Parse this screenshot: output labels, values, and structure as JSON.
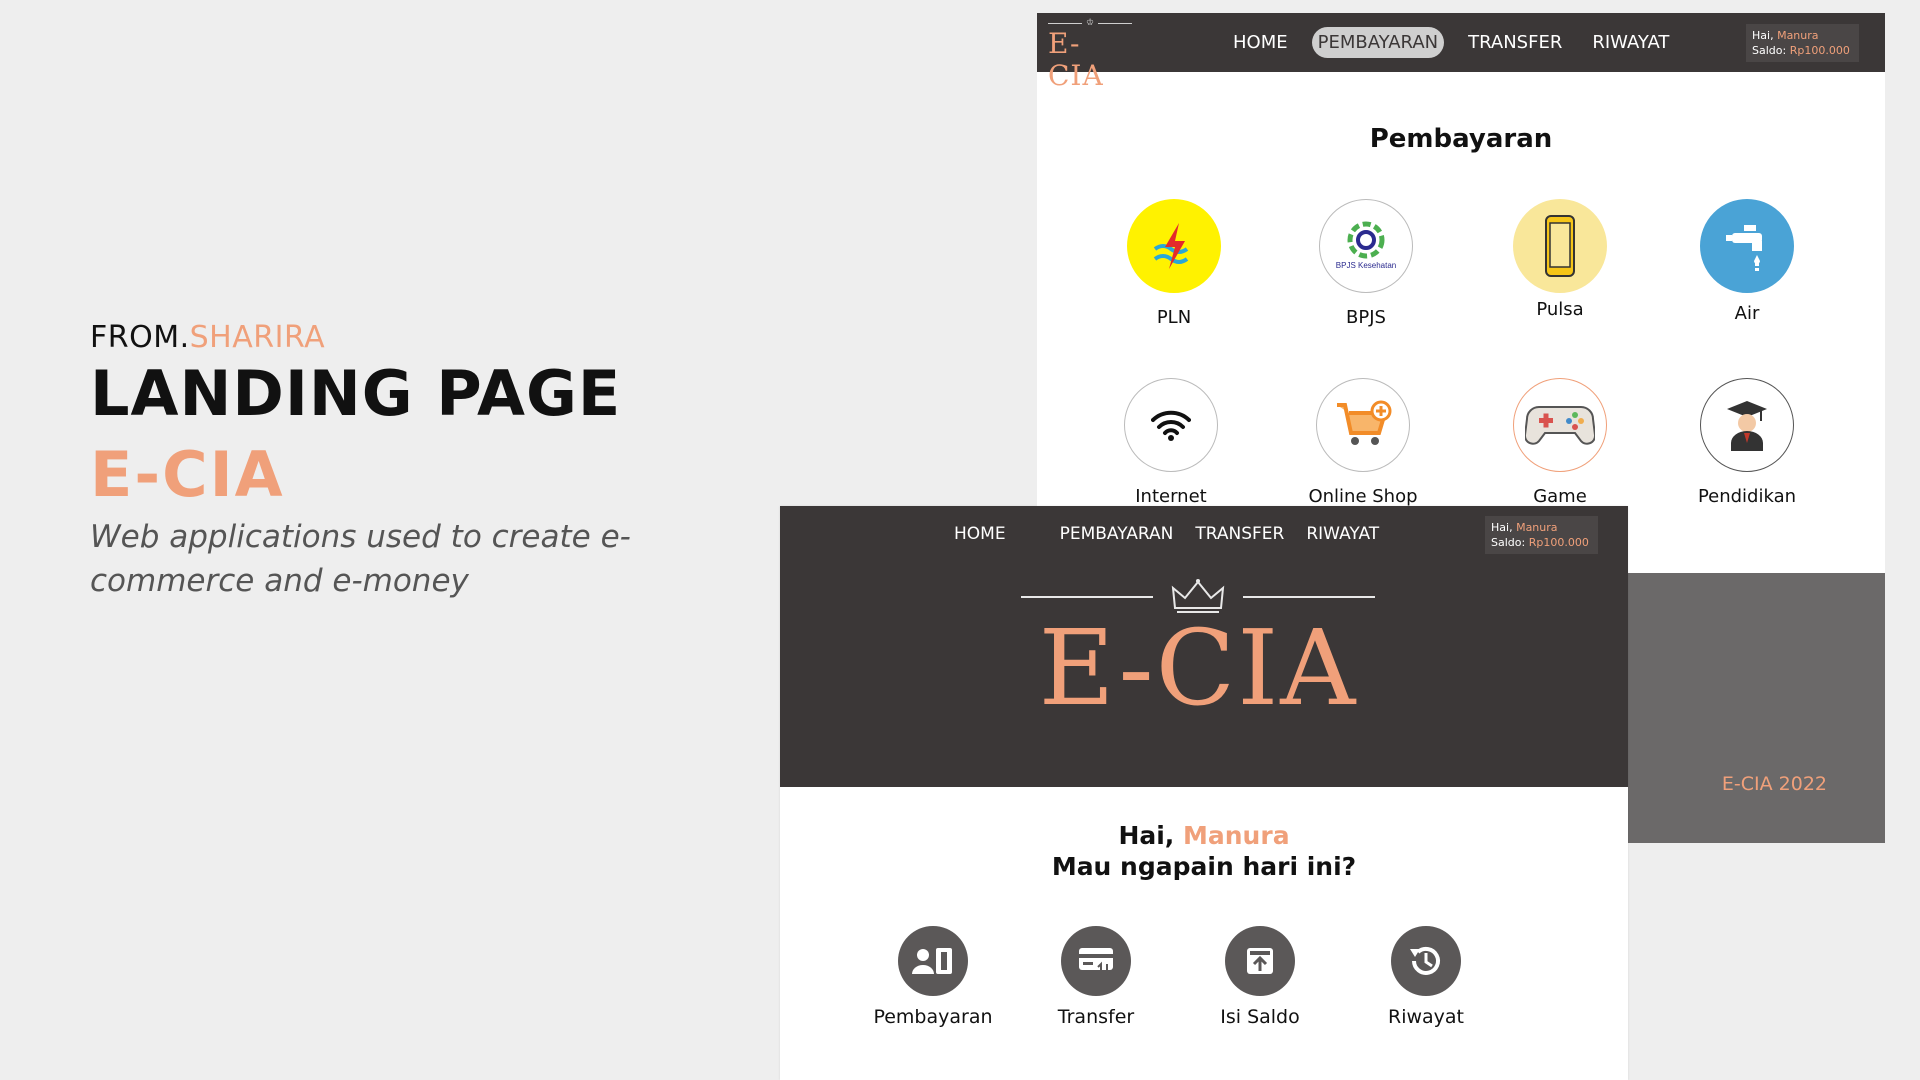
{
  "intro": {
    "from_prefix": "FROM.",
    "from_name": "SHARIRA",
    "heading": "LANDING PAGE",
    "app_name": "E-CIA",
    "description": "Web applications used to create e-commerce and e-money"
  },
  "brand": {
    "logo_text": "E-CIA",
    "accent_color": "#f0a07a",
    "dark_color": "#3b3737"
  },
  "payment_page": {
    "nav": {
      "links": [
        "HOME",
        "PEMBAYARAN",
        "TRANSFER",
        "RIWAYAT"
      ],
      "active": "PEMBAYARAN"
    },
    "user": {
      "greeting": "Hai,",
      "name": "Manura",
      "saldo_label": "Saldo:",
      "saldo_value": "Rp100.000"
    },
    "heading": "Pembayaran",
    "items": [
      {
        "label": "PLN",
        "icon": "lightning-icon",
        "bg": "#fff200"
      },
      {
        "label": "BPJS",
        "icon": "bpjs-logo-icon",
        "bg": "#ffffff"
      },
      {
        "label": "Pulsa",
        "icon": "phone-icon",
        "bg": "#f9e79a"
      },
      {
        "label": "Air",
        "icon": "water-tap-icon",
        "bg": "#4aa3d6"
      },
      {
        "label": "Internet",
        "icon": "wifi-icon",
        "bg": "#ffffff"
      },
      {
        "label": "Online Shop",
        "icon": "shopping-cart-icon",
        "bg": "#ffffff"
      },
      {
        "label": "Game",
        "icon": "gamepad-icon",
        "bg": "#ffffff"
      },
      {
        "label": "Pendidikan",
        "icon": "graduate-icon",
        "bg": "#ffffff"
      }
    ],
    "footer": "E-CIA 2022"
  },
  "home_page": {
    "nav": {
      "links": [
        "HOME",
        "PEMBAYARAN",
        "TRANSFER",
        "RIWAYAT"
      ]
    },
    "user": {
      "greeting": "Hai,",
      "name": "Manura",
      "saldo_label": "Saldo:",
      "saldo_value": "Rp100.000"
    },
    "hero_logo": "E-CIA",
    "greeting_prefix": "Hai,",
    "greeting_name": "Manura",
    "question": "Mau ngapain hari ini?",
    "actions": [
      {
        "label": "Pembayaran",
        "icon": "payment-card-icon"
      },
      {
        "label": "Transfer",
        "icon": "transfer-icon"
      },
      {
        "label": "Isi Saldo",
        "icon": "top-up-icon"
      },
      {
        "label": "Riwayat",
        "icon": "history-icon"
      }
    ]
  }
}
